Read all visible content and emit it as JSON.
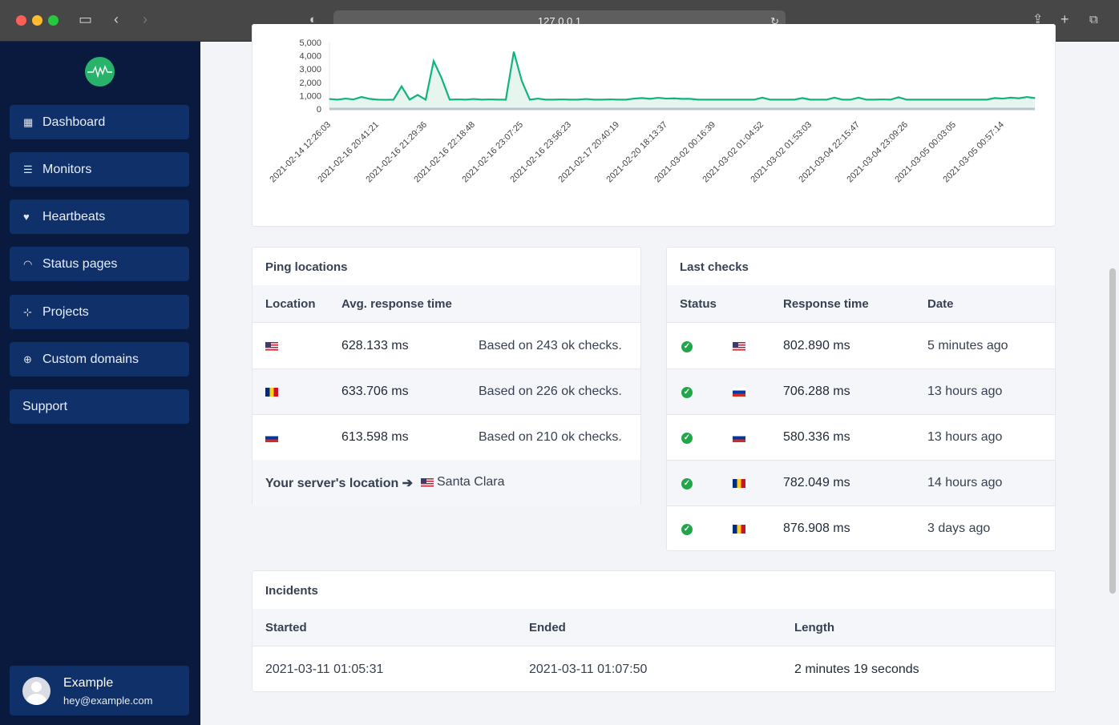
{
  "browser": {
    "url": "127.0.0.1"
  },
  "sidebar": {
    "items": [
      {
        "label": "Dashboard",
        "icon": "grid-icon"
      },
      {
        "label": "Monitors",
        "icon": "server-icon"
      },
      {
        "label": "Heartbeats",
        "icon": "heartbeat-icon"
      },
      {
        "label": "Status pages",
        "icon": "wifi-icon"
      },
      {
        "label": "Projects",
        "icon": "project-diagram-icon"
      },
      {
        "label": "Custom domains",
        "icon": "globe-icon"
      },
      {
        "label": "Support"
      }
    ],
    "user": {
      "name": "Example",
      "email": "hey@example.com"
    }
  },
  "chart_data": {
    "type": "area",
    "ylim": [
      0,
      5000
    ],
    "yticks": [
      "0",
      "1,000",
      "2,000",
      "3,000",
      "4,000",
      "5,000"
    ],
    "xtick_labels": [
      "2021-02-14 12:26:03",
      "2021-02-16 20:41:21",
      "2021-02-16 21:29:36",
      "2021-02-16 22:18:48",
      "2021-02-16 23:07:25",
      "2021-02-16 23:56:23",
      "2021-02-17 20:40:19",
      "2021-02-20 18:13:37",
      "2021-03-02 00:16:39",
      "2021-03-02 01:04:52",
      "2021-03-02 01:53:03",
      "2021-03-04 22:15:47",
      "2021-03-04 23:09:26",
      "2021-03-05 00:03:05",
      "2021-03-05 00:57:14"
    ],
    "values": [
      750,
      700,
      780,
      720,
      900,
      760,
      700,
      690,
      700,
      1700,
      700,
      1050,
      700,
      3600,
      2300,
      700,
      720,
      700,
      750,
      700,
      720,
      700,
      700,
      4300,
      2100,
      700,
      780,
      700,
      700,
      720,
      700,
      700,
      750,
      700,
      700,
      720,
      700,
      700,
      780,
      820,
      760,
      840,
      780,
      800,
      760,
      760,
      700,
      700,
      700,
      700,
      700,
      700,
      700,
      700,
      850,
      700,
      700,
      700,
      700,
      820,
      700,
      700,
      700,
      850,
      700,
      700,
      850,
      700,
      700,
      720,
      700,
      880,
      700,
      700,
      700,
      700,
      700,
      700,
      700,
      700,
      700,
      700,
      700,
      820,
      780,
      850,
      800,
      900,
      820
    ],
    "line_color": "#10b47c",
    "grid": false
  },
  "ping": {
    "title": "Ping locations",
    "headers": [
      "Location",
      "Avg. response time"
    ],
    "rows": [
      {
        "flag": "us",
        "avg": "628.133 ms",
        "note": "Based on 243 ok checks."
      },
      {
        "flag": "ro",
        "avg": "633.706 ms",
        "note": "Based on 226 ok checks."
      },
      {
        "flag": "ru",
        "avg": "613.598 ms",
        "note": "Based on 210 ok checks."
      }
    ],
    "server_label": "Your server's location",
    "server_flag": "us",
    "server_city": "Santa Clara"
  },
  "checks": {
    "title": "Last checks",
    "headers": [
      "Status",
      "Response time",
      "Date"
    ],
    "rows": [
      {
        "status": "ok",
        "flag": "us",
        "time": "802.890 ms",
        "date": "5 minutes ago"
      },
      {
        "status": "ok",
        "flag": "ru",
        "time": "706.288 ms",
        "date": "13 hours ago"
      },
      {
        "status": "ok",
        "flag": "ru",
        "time": "580.336 ms",
        "date": "13 hours ago"
      },
      {
        "status": "ok",
        "flag": "ro",
        "time": "782.049 ms",
        "date": "14 hours ago"
      },
      {
        "status": "ok",
        "flag": "ro",
        "time": "876.908 ms",
        "date": "3 days ago"
      }
    ]
  },
  "incidents": {
    "title": "Incidents",
    "headers": [
      "Started",
      "Ended",
      "Length"
    ],
    "rows": [
      {
        "started": "2021-03-11 01:05:31",
        "ended": "2021-03-11 01:07:50",
        "length": "2 minutes 19 seconds"
      }
    ]
  }
}
